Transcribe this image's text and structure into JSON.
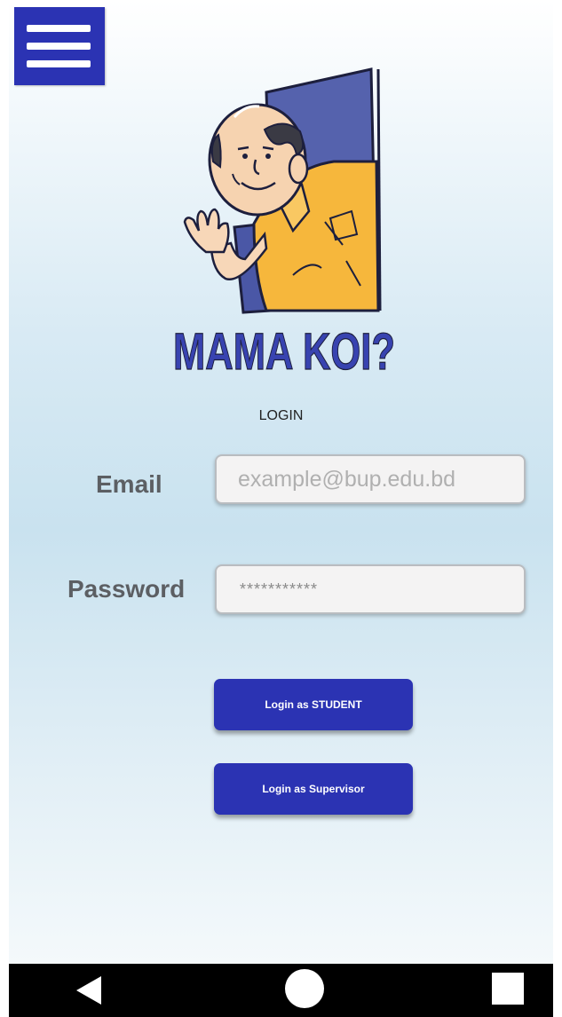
{
  "app": {
    "logo_text": "MAMA KOI?"
  },
  "menu": {
    "icon": "hamburger-menu-icon"
  },
  "login": {
    "heading": "LOGIN",
    "email_label": "Email",
    "email_placeholder": "example@bup.edu.bd",
    "password_label": "Password",
    "password_placeholder": "***********",
    "student_button": "Login as STUDENT",
    "supervisor_button": "Login as Supervisor"
  },
  "navigation": {
    "back_icon": "back-icon",
    "home_icon": "home-icon",
    "recents_icon": "recents-icon"
  },
  "colors": {
    "primary": "#2b33b3",
    "logo_text": "#3843b0",
    "shirt": "#f6b73c"
  }
}
